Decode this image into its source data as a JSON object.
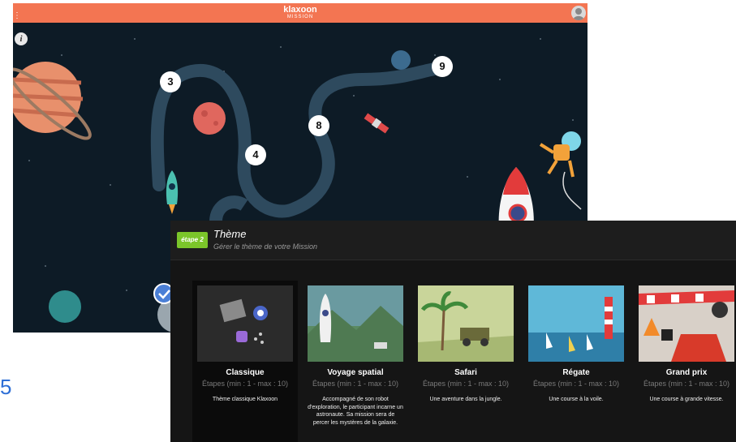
{
  "page_number": "5",
  "app": {
    "brand": "klaxoon",
    "subtitle": "MISSION",
    "steps": [
      "3",
      "4",
      "8",
      "9"
    ]
  },
  "panel": {
    "badge": "étape 2",
    "title": "Thème",
    "subtitle": "Gérer le thème de votre Mission",
    "themes": [
      {
        "name": "Classique",
        "steps": "Étapes (min : 1 - max : 10)",
        "description": "Thème classique Klaxoon",
        "selected": true
      },
      {
        "name": "Voyage spatial",
        "steps": "Étapes (min : 1 - max : 10)",
        "description": "Accompagné de son robot d'exploration, le participant incarne un astronaute. Sa mission sera de percer les mystères de la galaxie.",
        "selected": false
      },
      {
        "name": "Safari",
        "steps": "Étapes (min : 1 - max : 10)",
        "description": "Une aventure dans la jungle.",
        "selected": false
      },
      {
        "name": "Régate",
        "steps": "Étapes (min : 1 - max : 10)",
        "description": "Une course à la voile.",
        "selected": false
      },
      {
        "name": "Grand prix",
        "steps": "Étapes (min : 1 - max : 10)",
        "description": "Une course à grande vitesse.",
        "selected": false
      }
    ]
  },
  "colors": {
    "topbar": "#f37552",
    "space": "#0d1b26",
    "badge": "#7bc52a",
    "path": "#2e4a5e"
  }
}
